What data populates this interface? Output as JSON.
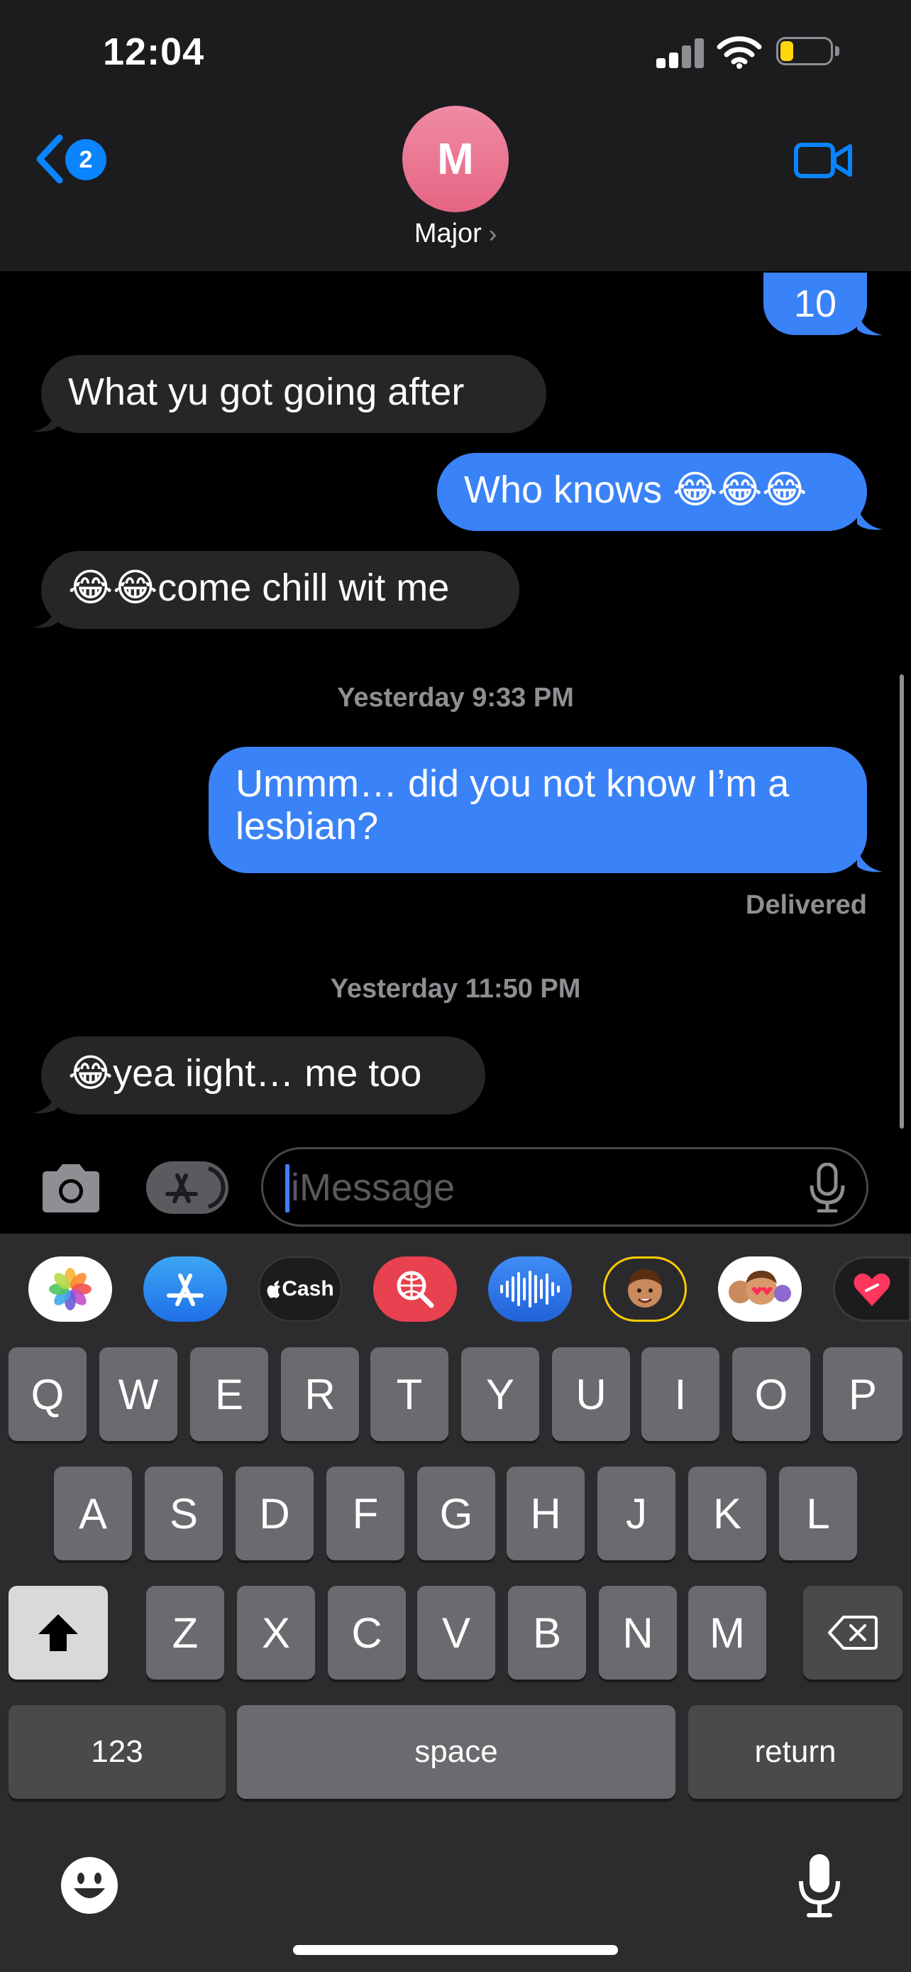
{
  "status_bar": {
    "time": "12:04"
  },
  "header": {
    "back_badge": "2",
    "avatar_initial": "M",
    "contact_name": "Major",
    "chevron": "›"
  },
  "messages": [
    {
      "type": "sent",
      "text": "10"
    },
    {
      "type": "received",
      "text": "What yu got going after"
    },
    {
      "type": "sent",
      "text": "Who knows 😂😂😂"
    },
    {
      "type": "received",
      "text": "😂😂come chill wit me"
    },
    {
      "type": "timestamp",
      "text": "Yesterday 9:33 PM"
    },
    {
      "type": "sent",
      "lines": [
        "Ummm… did you not know I’m a",
        "lesbian?"
      ]
    },
    {
      "type": "status",
      "text": "Delivered"
    },
    {
      "type": "timestamp",
      "text": "Yesterday 11:50 PM"
    },
    {
      "type": "received",
      "text": "😂yea iight… me too"
    }
  ],
  "input": {
    "placeholder": "iMessage"
  },
  "apps": [
    {
      "name": "photos-app",
      "icon": "photos-icon"
    },
    {
      "name": "app-store",
      "icon": "app-store-icon"
    },
    {
      "name": "apple-cash",
      "label": "Cash",
      "icon": "apple-cash-icon"
    },
    {
      "name": "image-search",
      "icon": "globe-search-icon"
    },
    {
      "name": "audio",
      "icon": "waveform-icon"
    },
    {
      "name": "memoji",
      "icon": "memoji-icon"
    },
    {
      "name": "memoji-stickers",
      "icon": "memoji-hearts-icon"
    },
    {
      "name": "digital-touch",
      "icon": "heart-icon"
    }
  ],
  "keyboard": {
    "row1": [
      "Q",
      "W",
      "E",
      "R",
      "T",
      "Y",
      "U",
      "I",
      "O",
      "P"
    ],
    "row2": [
      "A",
      "S",
      "D",
      "F",
      "G",
      "H",
      "J",
      "K",
      "L"
    ],
    "row3": [
      "Z",
      "X",
      "C",
      "V",
      "B",
      "N",
      "M"
    ],
    "numbers_label": "123",
    "space_label": "space",
    "return_label": "return"
  },
  "colors": {
    "sent_bubble": "#3a82f7",
    "received_bubble": "#262628",
    "accent": "#0a84ff",
    "avatar": "#ea7290"
  }
}
